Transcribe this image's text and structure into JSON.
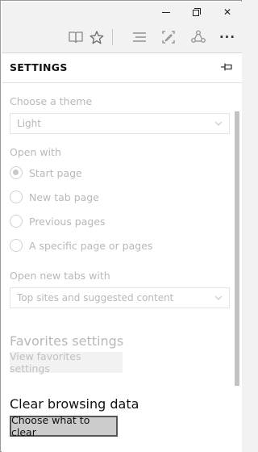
{
  "window": {
    "minimize_icon": "minimize-icon",
    "restore_icon": "restore-icon",
    "close_glyph": "✕"
  },
  "toolbar": {
    "icons": [
      "reading-view-icon",
      "favorite-star-icon",
      "hub-icon",
      "web-note-icon",
      "share-icon",
      "more-icon"
    ],
    "more_glyph": "···"
  },
  "settings": {
    "header": "SETTINGS",
    "pin_icon": "pin-icon",
    "theme": {
      "label": "Choose a theme",
      "selected": "Light"
    },
    "open_with": {
      "label": "Open with",
      "options": [
        {
          "label": "Start page",
          "checked": true
        },
        {
          "label": "New tab page",
          "checked": false
        },
        {
          "label": "Previous pages",
          "checked": false
        },
        {
          "label": "A specific page or pages",
          "checked": false
        }
      ]
    },
    "new_tabs": {
      "label": "Open new tabs with",
      "selected": "Top sites and suggested content"
    },
    "favorites": {
      "title": "Favorites settings",
      "button": "View favorites settings"
    },
    "clear": {
      "title": "Clear browsing data",
      "button": "Choose what to clear"
    }
  },
  "colors": {
    "disabled_text": "#b8b8b8",
    "scrollbar": "#c2c2c2",
    "button_bg": "#cccccc"
  }
}
